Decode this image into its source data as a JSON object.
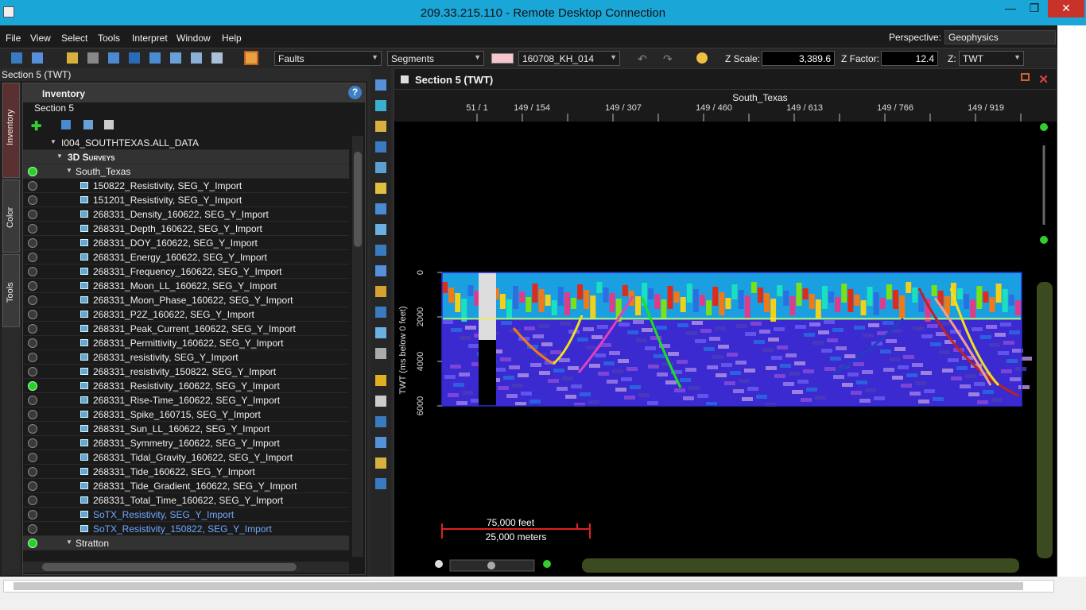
{
  "window": {
    "title": "209.33.215.110 - Remote Desktop Connection",
    "minimize": "—",
    "maximize": "❐",
    "close": "✕"
  },
  "menu": {
    "items": [
      "File",
      "View",
      "Select",
      "Tools",
      "Interpret",
      "Window",
      "Help"
    ],
    "perspective_label": "Perspective:",
    "perspective_value": "Geophysics"
  },
  "toolbar": {
    "faults_combo": "Faults",
    "segments_combo": "Segments",
    "color_swatch": "#f6c6cc",
    "horizon_combo": "160708_KH_014",
    "z_scale_label": "Z Scale:",
    "z_scale_value": "3,389.6",
    "z_factor_label": "Z Factor:",
    "z_factor_value": "12.4",
    "z_label": "Z:",
    "z_value": "TWT"
  },
  "left_pane": {
    "header": "Section 5 (TWT)",
    "side_tabs": [
      "Inventory",
      "Color",
      "Tools"
    ],
    "inventory_title": "Inventory",
    "help": "?",
    "subtitle": "Section 5",
    "tree": [
      {
        "kind": "root",
        "label": "I004_SOUTHTEXAS.ALL_DATA"
      },
      {
        "kind": "group",
        "label": "3D Surveys"
      },
      {
        "kind": "survey",
        "label": "South_Texas",
        "on": true
      },
      {
        "label": "150822_Resistivity, SEG_Y_Import",
        "on": false
      },
      {
        "label": "151201_Resistivity, SEG_Y_Import",
        "on": false
      },
      {
        "label": "268331_Density_160622, SEG_Y_Import",
        "on": false
      },
      {
        "label": "268331_Depth_160622, SEG_Y_Import",
        "on": false
      },
      {
        "label": "268331_DOY_160622, SEG_Y_Import",
        "on": false
      },
      {
        "label": "268331_Energy_160622, SEG_Y_Import",
        "on": false
      },
      {
        "label": "268331_Frequency_160622, SEG_Y_Import",
        "on": false
      },
      {
        "label": "268331_Moon_LL_160622, SEG_Y_Import",
        "on": false
      },
      {
        "label": "268331_Moon_Phase_160622, SEG_Y_Import",
        "on": false
      },
      {
        "label": "268331_P2Z_160622, SEG_Y_Import",
        "on": false
      },
      {
        "label": "268331_Peak_Current_160622, SEG_Y_Import",
        "on": false
      },
      {
        "label": "268331_Permittivity_160622, SEG_Y_Import",
        "on": false
      },
      {
        "label": "268331_resistivity, SEG_Y_Import",
        "on": false
      },
      {
        "label": "268331_resistivity_150822, SEG_Y_Import",
        "on": false
      },
      {
        "label": "268331_Resistivity_160622, SEG_Y_Import",
        "on": true
      },
      {
        "label": "268331_Rise-Time_160622, SEG_Y_Import",
        "on": false
      },
      {
        "label": "268331_Spike_160715, SEG_Y_Import",
        "on": false
      },
      {
        "label": "268331_Sun_LL_160622, SEG_Y_Import",
        "on": false
      },
      {
        "label": "268331_Symmetry_160622, SEG_Y_Import",
        "on": false
      },
      {
        "label": "268331_Tidal_Gravity_160622, SEG_Y_Import",
        "on": false
      },
      {
        "label": "268331_Tide_160622, SEG_Y_Import",
        "on": false
      },
      {
        "label": "268331_Tide_Gradient_160622, SEG_Y_Import",
        "on": false
      },
      {
        "label": "268331_Total_Time_160622, SEG_Y_Import",
        "on": false
      },
      {
        "label": "SoTX_Resistivity, SEG_Y_Import",
        "on": false,
        "blue": true
      },
      {
        "label": "SoTX_Resistivity_150822, SEG_Y_Import",
        "on": false,
        "blue": true
      },
      {
        "kind": "survey",
        "label": "Stratton",
        "on": true
      }
    ]
  },
  "section": {
    "title": "Section 5 (TWT)",
    "survey_label": "South_Texas",
    "top_ticks": [
      "51 / 1",
      "149 / 154",
      "149 / 307",
      "149 / 460",
      "149 / 613",
      "149 / 766",
      "149 / 919"
    ],
    "y_axis_label": "TWT (ms below 0 feet)",
    "y_ticks": [
      "0",
      "2000",
      "4000",
      "6000"
    ],
    "scale_feet": "75,000 feet",
    "scale_meters": "25,000 meters"
  }
}
